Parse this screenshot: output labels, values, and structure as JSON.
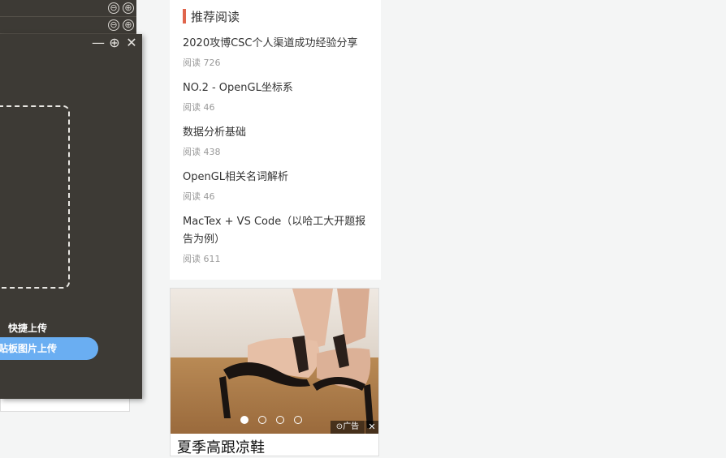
{
  "background_panel": {
    "row_controls": [
      "⊖",
      "⊕"
    ]
  },
  "upload_panel": {
    "controls": {
      "minimize": "—",
      "zoom": "⊕",
      "close": "✕"
    },
    "quick_upload_label": "快捷上传",
    "paste_button_label": "粘贴板图片上传",
    "paste_button_visible": "贴板图片上传",
    "accent_color": "#6aaef2"
  },
  "recommended": {
    "title": "推荐阅读",
    "accent_color": "#e0654c",
    "items": [
      {
        "title": "2020攻博CSC个人渠道成功经验分享",
        "reads": "阅读 726"
      },
      {
        "title": "NO.2 - OpenGL坐标系",
        "reads": "阅读 46"
      },
      {
        "title": "数据分析基础",
        "reads": "阅读 438"
      },
      {
        "title": "OpenGL相关名词解析",
        "reads": "阅读 46"
      },
      {
        "title": "MacTex + VS Code（以哈工大开题报告为例）",
        "reads": "阅读 611"
      }
    ]
  },
  "ad": {
    "caption": "夏季高跟凉鞋",
    "tag": "广告",
    "close": "✕",
    "slide_count": 4,
    "active_slide": 1
  }
}
